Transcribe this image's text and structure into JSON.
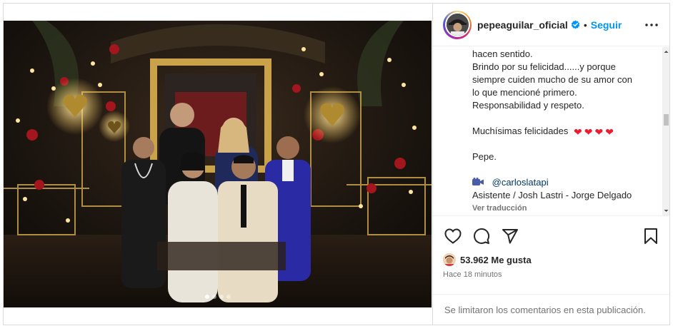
{
  "post": {
    "username": "pepeaguilar_oficial",
    "separator": "•",
    "follow_label": "Seguir",
    "more_icon": "more-horizontal-icon",
    "verified_icon": "verified-badge-icon",
    "carousel_dots": 4,
    "carousel_active_index": 0
  },
  "caption": {
    "lines_top": [
      "hacen sentido.",
      "Brindo por su felicidad......y porque",
      "siempre cuiden mucho de su amor con",
      "lo que mencioné primero.",
      "Responsabilidad y respeto."
    ],
    "felicidades": "Muchísimas felicidades",
    "hearts": [
      "❤",
      "❤",
      "❤",
      "❤"
    ],
    "signoff": "Pepe.",
    "camera_icon": "video-camera-icon",
    "mention": "@carloslatapi",
    "credits": "Asistente / Josh Lastri - Jorge Delgado",
    "translate_label": "Ver traducción"
  },
  "actions": {
    "like_icon": "heart-icon",
    "comment_icon": "comment-icon",
    "share_icon": "share-icon",
    "save_icon": "bookmark-icon",
    "likes_text": "53.962 Me gusta",
    "time_text": "Hace 18 minutos"
  },
  "comments": {
    "limited_text": "Se limitaron los comentarios en esta publicación."
  },
  "colors": {
    "accent_blue": "#0095f6",
    "heart_red": "#ed1c2e",
    "text": "#262626",
    "muted": "#737373"
  }
}
